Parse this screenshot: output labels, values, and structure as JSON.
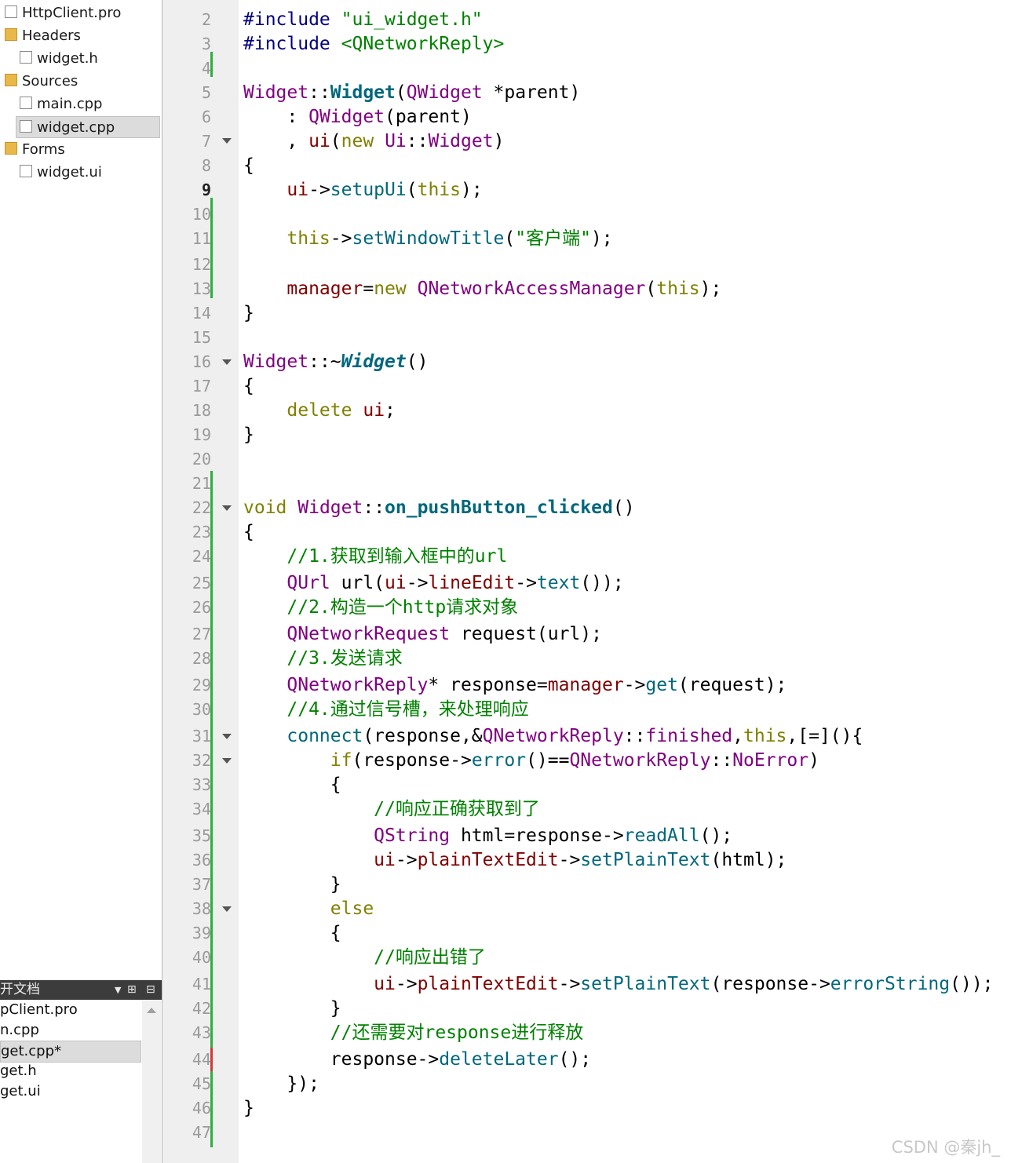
{
  "project_tree": [
    {
      "label": "HttpClient.pro",
      "icon": "pro-file-icon"
    },
    {
      "label": "Headers",
      "icon": "folder-icon"
    },
    {
      "label": "widget.h",
      "icon": "header-file-icon"
    },
    {
      "label": "Sources",
      "icon": "folder-icon"
    },
    {
      "label": "main.cpp",
      "icon": "cpp-file-icon"
    },
    {
      "label": "widget.cpp",
      "icon": "cpp-file-icon",
      "selected": true
    },
    {
      "label": "Forms",
      "icon": "folder-icon"
    },
    {
      "label": "widget.ui",
      "icon": "ui-file-icon"
    }
  ],
  "open_docs": {
    "title": "开文档",
    "items": [
      "pClient.pro",
      "n.cpp",
      "get.cpp*",
      "get.h",
      "get.ui"
    ],
    "selected": "get.cpp*"
  },
  "editor": {
    "current_line": "9",
    "line_numbers": [
      "2",
      "3",
      "4",
      "5",
      "6",
      "7",
      "8",
      "9",
      "10",
      "11",
      "12",
      "13",
      "14",
      "15",
      "16",
      "17",
      "18",
      "19",
      "20",
      "21",
      "22",
      "23",
      "24",
      "25",
      "26",
      "27",
      "28",
      "29",
      "30",
      "31",
      "32",
      "33",
      "34",
      "35",
      "36",
      "37",
      "38",
      "39",
      "40",
      "41",
      "42",
      "43",
      "44",
      "45",
      "46",
      "47"
    ],
    "code": [
      "#include \"ui_widget.h\"",
      "#include <QNetworkReply>",
      "",
      "Widget::Widget(QWidget *parent)",
      "    : QWidget(parent)",
      "    , ui(new Ui::Widget)",
      "{",
      "    ui->setupUi(this);",
      "",
      "    this->setWindowTitle(\"客户端\");",
      "",
      "    manager=new QNetworkAccessManager(this);",
      "}",
      "",
      "Widget::~Widget()",
      "{",
      "    delete ui;",
      "}",
      "",
      "",
      "void Widget::on_pushButton_clicked()",
      "{",
      "    //1.获取到输入框中的url",
      "    QUrl url(ui->lineEdit->text());",
      "    //2.构造一个http请求对象",
      "    QNetworkRequest request(url);",
      "    //3.发送请求",
      "    QNetworkReply* response=manager->get(request);",
      "    //4.通过信号槽，来处理响应",
      "    connect(response,&QNetworkReply::finished,this,[=](){",
      "        if(response->error()==QNetworkReply::NoError)",
      "        {",
      "            //响应正确获取到了",
      "            QString html=response->readAll();",
      "            ui->plainTextEdit->setPlainText(html);",
      "        }",
      "        else",
      "        {",
      "            //响应出错了",
      "            ui->plainTextEdit->setPlainText(response->errorString());",
      "        }",
      "        //还需要对response进行释放",
      "        response->deleteLater();",
      "    });",
      "}",
      ""
    ]
  },
  "watermark": "CSDN @秦jh_"
}
